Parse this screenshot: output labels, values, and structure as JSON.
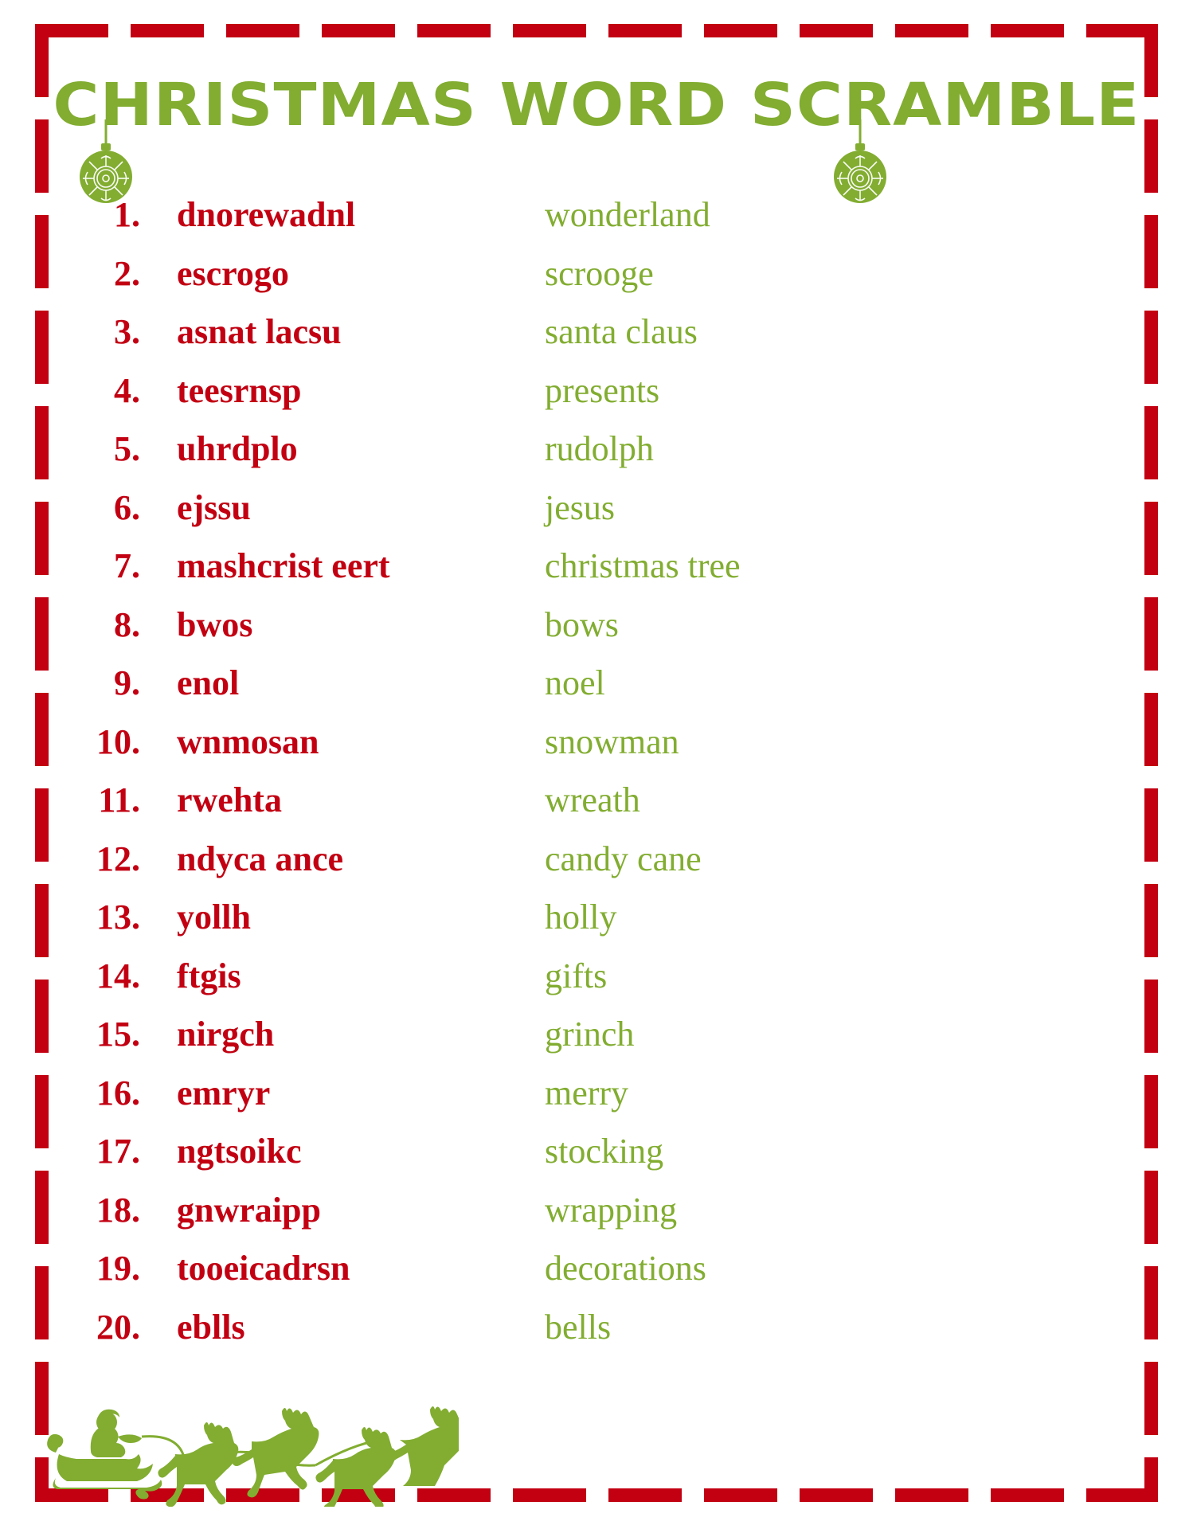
{
  "title": "CHRISTMAS WORD SCRAMBLE",
  "colors": {
    "red": "#C20012",
    "green": "#82AD31",
    "background": "#FFFFFF"
  },
  "decorations": {
    "ornament_left": "ornament-ball-icon",
    "ornament_right": "ornament-ball-icon",
    "footer_graphic": "santa-sleigh-reindeer-icon",
    "border_style": "red-dashed-frame"
  },
  "word_list": [
    {
      "num": "1.",
      "scramble": "dnorewadnl",
      "answer": "wonderland"
    },
    {
      "num": "2.",
      "scramble": "escrogo",
      "answer": "scrooge"
    },
    {
      "num": "3.",
      "scramble": "asnat lacsu",
      "answer": "santa claus"
    },
    {
      "num": "4.",
      "scramble": "teesrnsp",
      "answer": "presents"
    },
    {
      "num": "5.",
      "scramble": "uhrdplo",
      "answer": "rudolph"
    },
    {
      "num": "6.",
      "scramble": "ejssu",
      "answer": "jesus"
    },
    {
      "num": "7.",
      "scramble": "mashcrist eert",
      "answer": "christmas tree"
    },
    {
      "num": "8.",
      "scramble": "bwos",
      "answer": "bows"
    },
    {
      "num": "9.",
      "scramble": "enol",
      "answer": "noel"
    },
    {
      "num": "10.",
      "scramble": "wnmosan",
      "answer": "snowman"
    },
    {
      "num": "11.",
      "scramble": "rwehta",
      "answer": "wreath"
    },
    {
      "num": "12.",
      "scramble": "ndyca ance",
      "answer": "candy cane"
    },
    {
      "num": "13.",
      "scramble": "yollh",
      "answer": "holly"
    },
    {
      "num": "14.",
      "scramble": "ftgis",
      "answer": "gifts"
    },
    {
      "num": "15.",
      "scramble": "nirgch",
      "answer": "grinch"
    },
    {
      "num": "16.",
      "scramble": "emryr",
      "answer": "merry"
    },
    {
      "num": "17.",
      "scramble": "ngtsoikc",
      "answer": "stocking"
    },
    {
      "num": "18.",
      "scramble": "gnwraipp",
      "answer": "wrapping"
    },
    {
      "num": "19.",
      "scramble": "tooeicadrsn",
      "answer": "decorations"
    },
    {
      "num": "20.",
      "scramble": "eblls",
      "answer": "bells"
    }
  ]
}
